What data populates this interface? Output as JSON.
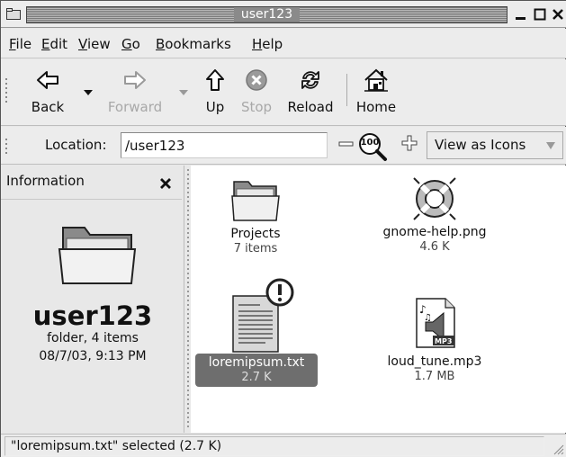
{
  "window": {
    "title": "user123",
    "buttons": [
      "minimize",
      "maximize",
      "close"
    ]
  },
  "menubar": {
    "items": [
      {
        "label": "File",
        "mnemonic": "F"
      },
      {
        "label": "Edit",
        "mnemonic": "E"
      },
      {
        "label": "View",
        "mnemonic": "V"
      },
      {
        "label": "Go",
        "mnemonic": "G"
      },
      {
        "label": "Bookmarks",
        "mnemonic": "B"
      },
      {
        "label": "Help",
        "mnemonic": "H"
      }
    ]
  },
  "toolbar": {
    "back": {
      "label": "Back",
      "icon": "arrow-left-icon",
      "enabled": true
    },
    "forward": {
      "label": "Forward",
      "icon": "arrow-right-icon",
      "enabled": false
    },
    "up": {
      "label": "Up",
      "icon": "arrow-up-icon",
      "enabled": true
    },
    "stop": {
      "label": "Stop",
      "icon": "stop-icon",
      "enabled": false
    },
    "reload": {
      "label": "Reload",
      "icon": "reload-icon",
      "enabled": true
    },
    "home": {
      "label": "Home",
      "icon": "home-icon",
      "enabled": true
    }
  },
  "location": {
    "label": "Location:",
    "value": "/user123",
    "zoom_level": "100",
    "view_mode": "View as Icons"
  },
  "sidepane": {
    "header": "Information",
    "folder_name": "user123",
    "folder_info": "folder, 4 items",
    "modified": "08/7/03, 9:13 PM"
  },
  "files": [
    {
      "name": "Projects",
      "meta": "7 items",
      "icon": "folder-icon",
      "selected": false
    },
    {
      "name": "gnome-help.png",
      "meta": "4.6 K",
      "icon": "lifebuoy-icon",
      "selected": false
    },
    {
      "name": "loremipsum.txt",
      "meta": "2.7 K",
      "icon": "text-document-icon",
      "selected": true,
      "emblem": "important-emblem-icon"
    },
    {
      "name": "loud_tune.mp3",
      "meta": "1.7 MB",
      "icon": "mp3-audio-icon",
      "selected": false
    }
  ],
  "status": {
    "text": "\"loremipsum.txt\" selected (2.7 K)"
  },
  "colors": {
    "chrome": "#ececec",
    "selection": "#6e6e6e",
    "title_text": "#ffffff"
  }
}
